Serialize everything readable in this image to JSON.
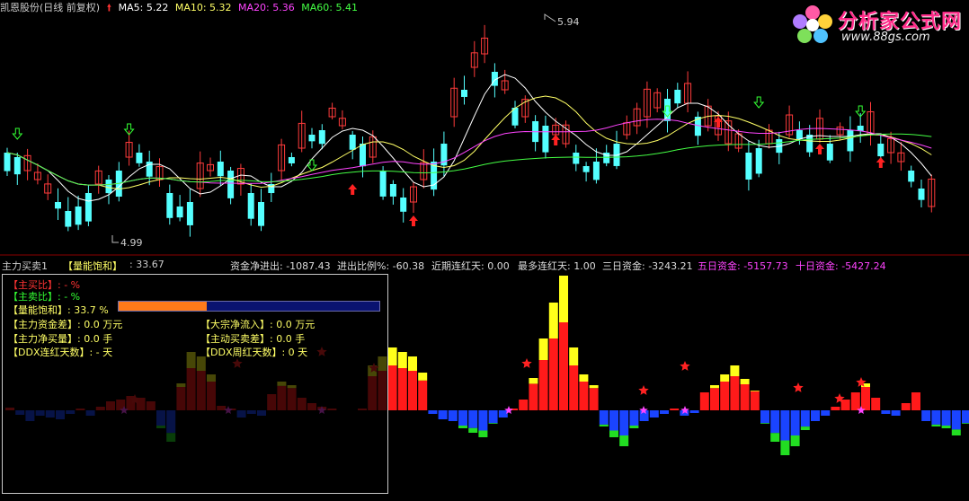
{
  "header": {
    "title": "凯恩股份(日线 前复权)",
    "ma5": "MA5: 5.22",
    "ma10": "MA10: 5.32",
    "ma20": "MA20: 5.36",
    "ma60": "MA60: 5.41",
    "colors": {
      "ma5": "#ffffff",
      "ma10": "#ffff66",
      "ma20": "#ff44ff",
      "ma60": "#44ff44"
    }
  },
  "price_annotations": {
    "high": "5.94",
    "low": "4.99"
  },
  "indicator_line": {
    "name": "主力买卖1",
    "saturation_label": "【量能饱和】",
    "saturation_value": ": 33.67",
    "net_flow": "资金净进出: -1087.43",
    "net_ratio": "进出比例%: -60.38",
    "recent_red": "近期连红天: 0.00",
    "max_red": "最多连红天: 1.00",
    "three_day": "三日资金: -3243.21",
    "five_day": "五日资金: -5157.73",
    "ten_day": "十日资金: -5427.24"
  },
  "panel": {
    "main_buy_ratio": "【主买比】:  -  %",
    "main_sell_ratio": "【主卖比】:  -  %",
    "saturation": "【量能饱和】:  33.7  %",
    "saturation_fraction": 0.337,
    "main_diff": "【主力资金差】: 0.0 万元",
    "big_inflow": "【大宗净流入】: 0.0 万元",
    "main_net_buy": "【主力净买量】: 0.0 手",
    "active_buy_diff": "【主动买卖差】: 0.0 手",
    "ddx_red_days": "【DDX连红天数】: - 天",
    "ddx_week_red": "【DDX周红天数】: 0 天"
  },
  "logo": {
    "title": "分析家公式网",
    "url": "www.88gs.com"
  }
}
